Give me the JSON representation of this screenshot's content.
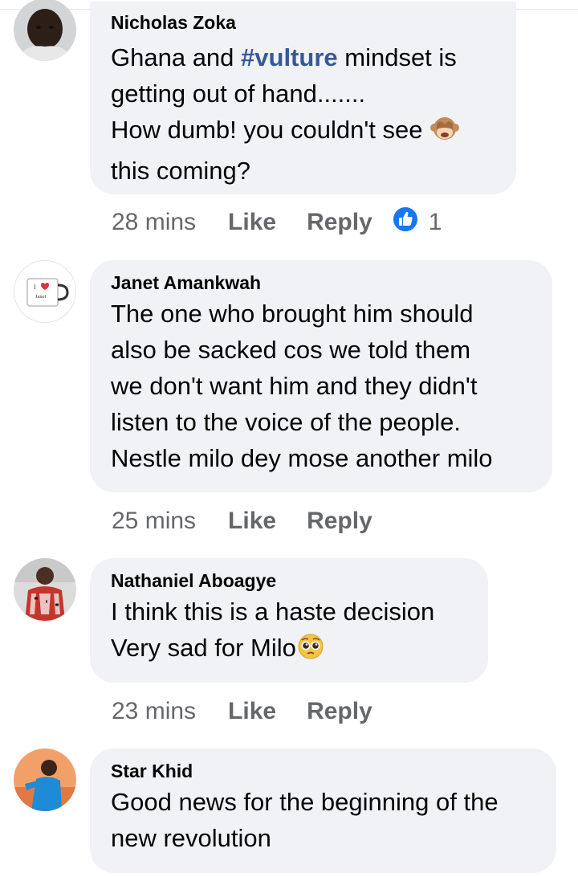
{
  "comments": [
    {
      "author": "Nicholas Zoka",
      "lines": {
        "l1_pre": "Ghana and ",
        "l1_tag": "#vulture",
        "l1_post": " mindset is",
        "l2": "getting out of hand.......",
        "l3": "How dumb! you couldn't see ",
        "l4": "this coming?"
      },
      "emoji": "see-no-evil-monkey",
      "time": "28 mins",
      "like": "Like",
      "reply": "Reply",
      "reactions": {
        "icon": "thumbs-up-icon",
        "count": "1",
        "color": "#1877f2"
      }
    },
    {
      "author": "Janet Amankwah",
      "lines": {
        "l1": "The one who brought him should",
        "l2": "also be sacked cos we told them",
        "l3": "we don't want him and they didn't",
        "l4": "listen to the voice of the people.",
        "l5": "Nestle milo dey mose another milo"
      },
      "avatar_mug": {
        "line1": "I",
        "line2": "Janet"
      },
      "time": "25 mins",
      "like": "Like",
      "reply": "Reply"
    },
    {
      "author": "Nathaniel Aboagye",
      "lines": {
        "l1": "I think this is a haste decision",
        "l2": "Very sad for Milo"
      },
      "emoji": "pleading-face",
      "time": "23 mins",
      "like": "Like",
      "reply": "Reply"
    },
    {
      "author": "Star Khid",
      "lines": {
        "l1": "Good news for the beginning of the",
        "l2": "new revolution"
      }
    }
  ],
  "colors": {
    "bubble": "#f0f2f5",
    "meta_text": "#65676b",
    "hashtag": "#385898",
    "like_blue": "#1877f2"
  }
}
